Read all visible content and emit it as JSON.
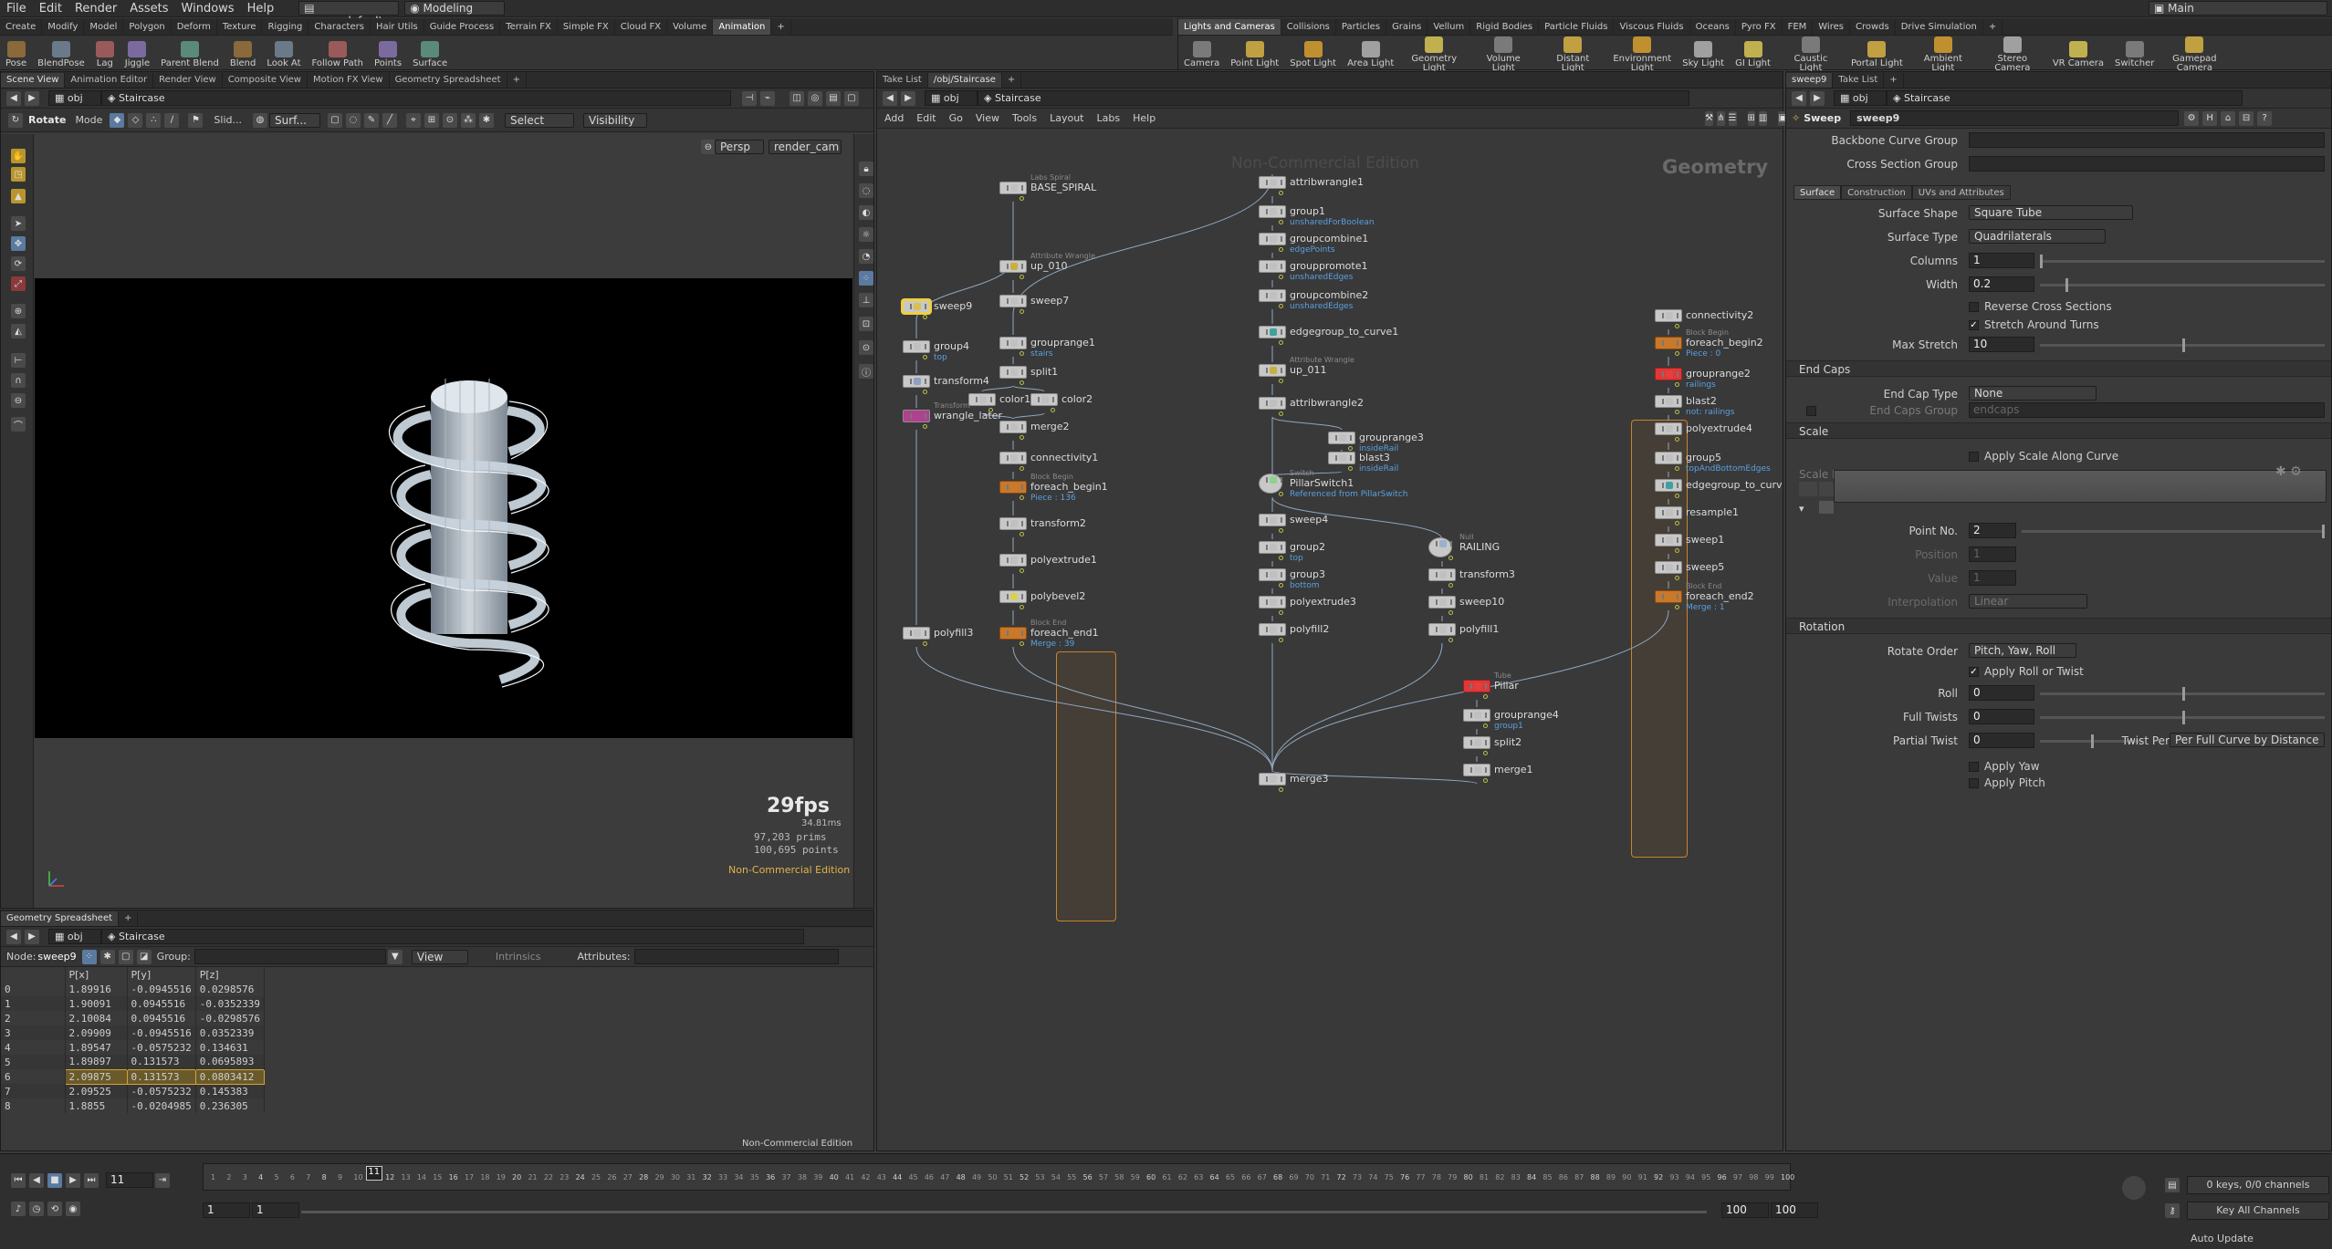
{
  "menubar": {
    "items": [
      "File",
      "Edit",
      "Render",
      "Assets",
      "Windows",
      "Help"
    ],
    "scene_file": "myme_default",
    "desktop": "Modeling",
    "workspace": "Main"
  },
  "shelf_left": {
    "tabs": [
      "Create",
      "Modify",
      "Model",
      "Polygon",
      "Deform",
      "Texture",
      "Rigging",
      "Characters",
      "Hair Utils",
      "Guide Process",
      "Terrain FX",
      "Simple FX",
      "Cloud FX",
      "Volume",
      "Animation"
    ],
    "active": "Animation",
    "tools": [
      "Pose",
      "BlendPose",
      "Lag",
      "Jiggle",
      "Parent Blend",
      "Blend",
      "Look At",
      "Follow Path",
      "Points",
      "Surface"
    ]
  },
  "shelf_right": {
    "tabs": [
      "Lights and Cameras",
      "Collisions",
      "Particles",
      "Grains",
      "Vellum",
      "Rigid Bodies",
      "Particle Fluids",
      "Viscous Fluids",
      "Oceans",
      "Pyro FX",
      "FEM",
      "Wires",
      "Crowds",
      "Drive Simulation"
    ],
    "active": "Lights and Cameras",
    "tools": [
      "Camera",
      "Point Light",
      "Spot Light",
      "Area Light",
      "Geometry Light",
      "Volume Light",
      "Distant Light",
      "Environment Light",
      "Sky Light",
      "GI Light",
      "Caustic Light",
      "Portal Light",
      "Ambient Light",
      "Stereo Camera",
      "VR Camera",
      "Switcher",
      "Gamepad Camera"
    ]
  },
  "viewer": {
    "tabs": [
      "Scene View",
      "Animation Editor",
      "Render View",
      "Composite View",
      "Motion FX View",
      "Geometry Spreadsheet"
    ],
    "path_root": "obj",
    "path_node": "Staircase",
    "toolbar": {
      "rotate": "Rotate",
      "mode": "Mode",
      "slide": "Slid...",
      "surf": "Surf...",
      "select": "Select",
      "visibility": "Visibility"
    },
    "camera": "Persp",
    "render_cam": "render_cam",
    "fps": "29fps",
    "ms": "34.81ms",
    "prims": "97,203  prims",
    "points": "100,695 points",
    "watermark": "Non-Commercial Edition"
  },
  "spreadsheet": {
    "tab": "Geometry Spreadsheet",
    "path_root": "obj",
    "path_node": "Staircase",
    "node_label": "Node:",
    "node": "sweep9",
    "group_label": "Group:",
    "view": "View",
    "intrinsics": "Intrinsics",
    "attributes": "Attributes:",
    "watermark": "Non-Commercial Edition",
    "columns": [
      "",
      "P[x]",
      "P[y]",
      "P[z]"
    ],
    "rows": [
      [
        "0",
        "1.89916",
        "-0.0945516",
        "0.0298576"
      ],
      [
        "1",
        "1.90091",
        "0.0945516",
        "-0.0352339"
      ],
      [
        "2",
        "2.10084",
        "0.0945516",
        "-0.0298576"
      ],
      [
        "3",
        "2.09909",
        "-0.0945516",
        "0.0352339"
      ],
      [
        "4",
        "1.89547",
        "-0.0575232",
        "0.134631"
      ],
      [
        "5",
        "1.89897",
        "0.131573",
        "0.0695893"
      ],
      [
        "6",
        "2.09875",
        "0.131573",
        "0.0803412"
      ],
      [
        "7",
        "2.09525",
        "-0.0575232",
        "0.145383"
      ],
      [
        "8",
        "1.8855",
        "-0.0204985",
        "0.236305"
      ]
    ]
  },
  "network": {
    "tabs": [
      "Take List",
      "/obj/Staircase"
    ],
    "path_root": "obj",
    "path_node": "Staircase",
    "menu": [
      "Add",
      "Edit",
      "Go",
      "View",
      "Tools",
      "Layout",
      "Labs",
      "Help"
    ],
    "context": "Geometry",
    "watermark": "Non-Commercial Edition",
    "nodes": [
      {
        "label": "BASE_SPIRAL",
        "type": "Labs Spiral",
        "sub": ""
      },
      {
        "label": "up_010",
        "type": "Attribute Wrangle",
        "sub": ""
      },
      {
        "label": "sweep7",
        "type": "",
        "sub": ""
      },
      {
        "label": "sweep9",
        "type": "",
        "sub": ""
      },
      {
        "label": "group4",
        "type": "",
        "sub": "top"
      },
      {
        "label": "transform4",
        "type": "",
        "sub": ""
      },
      {
        "label": "wrangle_later",
        "type": "Transform",
        "sub": ""
      },
      {
        "label": "polyfill3",
        "type": "",
        "sub": ""
      },
      {
        "label": "grouprange1",
        "type": "",
        "sub": "stairs"
      },
      {
        "label": "split1",
        "type": "",
        "sub": ""
      },
      {
        "label": "color1",
        "type": "",
        "sub": ""
      },
      {
        "label": "color2",
        "type": "",
        "sub": ""
      },
      {
        "label": "merge2",
        "type": "",
        "sub": ""
      },
      {
        "label": "connectivity1",
        "type": "",
        "sub": ""
      },
      {
        "label": "foreach_begin1",
        "type": "Block Begin",
        "sub": "Piece : 136"
      },
      {
        "label": "transform2",
        "type": "",
        "sub": ""
      },
      {
        "label": "polyextrude1",
        "type": "",
        "sub": ""
      },
      {
        "label": "polybevel2",
        "type": "",
        "sub": ""
      },
      {
        "label": "foreach_end1",
        "type": "Block End",
        "sub": "Merge : 39"
      },
      {
        "label": "attribwrangle1",
        "type": "",
        "sub": ""
      },
      {
        "label": "group1",
        "type": "",
        "sub": "unsharedForBoolean"
      },
      {
        "label": "groupcombine1",
        "type": "",
        "sub": "edgePoints"
      },
      {
        "label": "grouppromote1",
        "type": "",
        "sub": "unsharedEdges"
      },
      {
        "label": "groupcombine2",
        "type": "",
        "sub": "unsharedEdges"
      },
      {
        "label": "edgegroup_to_curve1",
        "type": "",
        "sub": ""
      },
      {
        "label": "up_011",
        "type": "Attribute Wrangle",
        "sub": ""
      },
      {
        "label": "attribwrangle2",
        "type": "",
        "sub": ""
      },
      {
        "label": "grouprange3",
        "type": "",
        "sub": "insideRail"
      },
      {
        "label": "blast3",
        "type": "",
        "sub": "insideRail"
      },
      {
        "label": "PillarSwitch1",
        "type": "Switch",
        "sub": "Referenced from PillarSwitch"
      },
      {
        "label": "sweep4",
        "type": "",
        "sub": ""
      },
      {
        "label": "group2",
        "type": "",
        "sub": "top"
      },
      {
        "label": "group3",
        "type": "",
        "sub": "bottom"
      },
      {
        "label": "polyextrude3",
        "type": "",
        "sub": ""
      },
      {
        "label": "polyfill2",
        "type": "",
        "sub": ""
      },
      {
        "label": "RAILING",
        "type": "Null",
        "sub": ""
      },
      {
        "label": "transform3",
        "type": "",
        "sub": ""
      },
      {
        "label": "sweep10",
        "type": "",
        "sub": ""
      },
      {
        "label": "polyfill1",
        "type": "",
        "sub": ""
      },
      {
        "label": "connectivity2",
        "type": "",
        "sub": ""
      },
      {
        "label": "foreach_begin2",
        "type": "Block Begin",
        "sub": "Piece : 0"
      },
      {
        "label": "grouprange2",
        "type": "",
        "sub": "railings"
      },
      {
        "label": "blast2",
        "type": "",
        "sub": "not: railings"
      },
      {
        "label": "polyextrude4",
        "type": "",
        "sub": ""
      },
      {
        "label": "group5",
        "type": "",
        "sub": "topAndBottomEdges"
      },
      {
        "label": "edgegroup_to_curve2",
        "type": "",
        "sub": ""
      },
      {
        "label": "resample1",
        "type": "",
        "sub": ""
      },
      {
        "label": "sweep1",
        "type": "",
        "sub": ""
      },
      {
        "label": "sweep5",
        "type": "",
        "sub": ""
      },
      {
        "label": "foreach_end2",
        "type": "Block End",
        "sub": "Merge : 1"
      },
      {
        "label": "Pillar",
        "type": "Tube",
        "sub": ""
      },
      {
        "label": "grouprange4",
        "type": "",
        "sub": "group1"
      },
      {
        "label": "split2",
        "type": "",
        "sub": ""
      },
      {
        "label": "merge1",
        "type": "",
        "sub": ""
      },
      {
        "label": "merge3",
        "type": "",
        "sub": ""
      }
    ]
  },
  "params": {
    "tabs": [
      "sweep9",
      "Take List"
    ],
    "path_root": "obj",
    "path_node": "Staircase",
    "op_type": "Sweep",
    "op_name": "sweep9",
    "backbone_label": "Backbone Curve Group",
    "cross_label": "Cross Section Group",
    "sub_tabs": [
      "Surface",
      "Construction",
      "UVs and Attributes"
    ],
    "surface_shape_label": "Surface Shape",
    "surface_shape": "Square Tube",
    "surface_type_label": "Surface Type",
    "surface_type": "Quadrilaterals",
    "columns_label": "Columns",
    "columns": "1",
    "width_label": "Width",
    "width": "0.2",
    "width_fraction": 0.09,
    "reverse_label": "Reverse Cross Sections",
    "stretch_label": "Stretch Around Turns",
    "max_stretch_label": "Max Stretch",
    "max_stretch": "10",
    "max_stretch_fraction": 0.5,
    "end_caps": "End Caps",
    "end_cap_type_label": "End Cap Type",
    "end_cap_type": "None",
    "end_caps_group_label": "End Caps Group",
    "end_caps_group_ph": "endcaps",
    "scale": "Scale",
    "apply_scale_label": "Apply Scale Along Curve",
    "scale_ramp": "Scale Ramp",
    "point_no_label": "Point No.",
    "point_no": "2",
    "position_label": "Position",
    "position": "1",
    "value_label": "Value",
    "value": "1",
    "interp_label": "Interpolation",
    "interp": "Linear",
    "rotation": "Rotation",
    "rot_order_label": "Rotate Order",
    "rot_order": "Pitch, Yaw, Roll",
    "apply_roll_label": "Apply Roll or Twist",
    "roll_label": "Roll",
    "roll": "0",
    "full_twists_label": "Full Twists",
    "full_twists": "0",
    "partial_twist_label": "Partial Twist",
    "partial_twist": "0",
    "twist_per_label": "Twist Per",
    "twist_per": "Per Full Curve by Distance",
    "apply_yaw_label": "Apply Yaw",
    "apply_pitch_label": "Apply Pitch"
  },
  "timeline": {
    "frame": "11",
    "start": "1",
    "start2": "1",
    "end": "100",
    "end2": "100",
    "ticks": [
      "1",
      "2",
      "3",
      "4",
      "5",
      "6",
      "7",
      "8",
      "9",
      "10",
      "11",
      "12",
      "13",
      "14",
      "15",
      "16",
      "17",
      "18",
      "19",
      "20",
      "21",
      "22",
      "23",
      "24",
      "25",
      "26",
      "27",
      "28",
      "29",
      "30",
      "31",
      "32",
      "33",
      "34",
      "35",
      "36",
      "37",
      "38",
      "39",
      "40",
      "41",
      "42",
      "43",
      "44",
      "45",
      "46",
      "47",
      "48",
      "49",
      "50",
      "51",
      "52",
      "53",
      "54",
      "55",
      "56",
      "57",
      "58",
      "59",
      "60",
      "61",
      "62",
      "63",
      "64",
      "65",
      "66",
      "67",
      "68",
      "69",
      "70",
      "71",
      "72",
      "73",
      "74",
      "75",
      "76",
      "77",
      "78",
      "79",
      "80",
      "81",
      "82",
      "83",
      "84",
      "85",
      "86",
      "87",
      "88",
      "89",
      "90",
      "91",
      "92",
      "93",
      "94",
      "95",
      "96",
      "97",
      "98",
      "99",
      "100"
    ],
    "keys": "0 keys, 0/0 channels",
    "key_all": "Key All Channels",
    "auto_update": "Auto Update"
  }
}
